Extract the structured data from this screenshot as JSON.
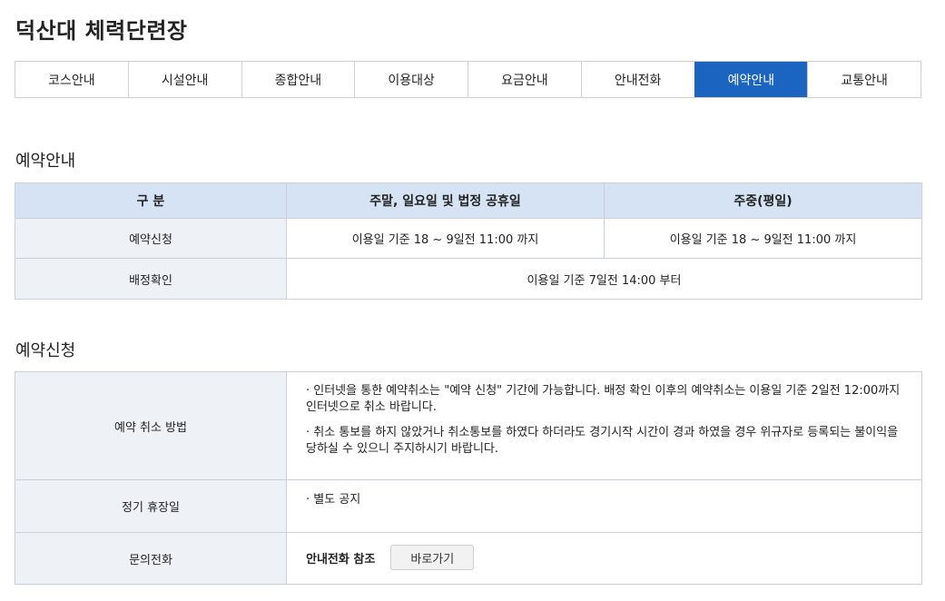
{
  "page": {
    "title": "덕산대 체력단련장"
  },
  "nav": {
    "tabs": [
      {
        "label": "코스안내"
      },
      {
        "label": "시설안내"
      },
      {
        "label": "종합안내"
      },
      {
        "label": "이용대상"
      },
      {
        "label": "요금안내"
      },
      {
        "label": "안내전화"
      },
      {
        "label": "예약안내",
        "active": true
      },
      {
        "label": "교통안내"
      }
    ],
    "active_color": "#1b64bf"
  },
  "reservation_info": {
    "title": "예약안내",
    "headers": [
      "구 분",
      "주말, 일요일 및 법정 공휴일",
      "주중(평일)"
    ],
    "rows": [
      {
        "label": "예약신청",
        "weekend": "이용일 기준 18 ~ 9일전 11:00 까지",
        "weekday": "이용일 기준 18 ~ 9일전 11:00 까지"
      },
      {
        "label": "배정확인",
        "all": "이용일 기준 7일전 14:00 부터"
      }
    ]
  },
  "reservation_apply": {
    "title": "예약신청",
    "cancel": {
      "label": "예약 취소 방법",
      "bullets": [
        "· 인터넷을 통한 예약취소는 \"예약 신청\" 기간에 가능합니다. 배정 확인 이후의 예약취소는 이용일 기준 2일전 12:00까지 인터넷으로 취소 바랍니다.",
        "· 취소 통보를 하지 않았거나 취소통보를 하였다 하더라도 경기시작 시간이 경과 하였을 경우 위규자로 등록되는 불이익을 당하실 수 있으니 주지하시기 바랍니다."
      ]
    },
    "holiday": {
      "label": "정기 휴장일",
      "value": "· 별도 공지"
    },
    "contact": {
      "label": "문의전화",
      "text": "안내전화 참조",
      "button": "바로가기"
    }
  }
}
